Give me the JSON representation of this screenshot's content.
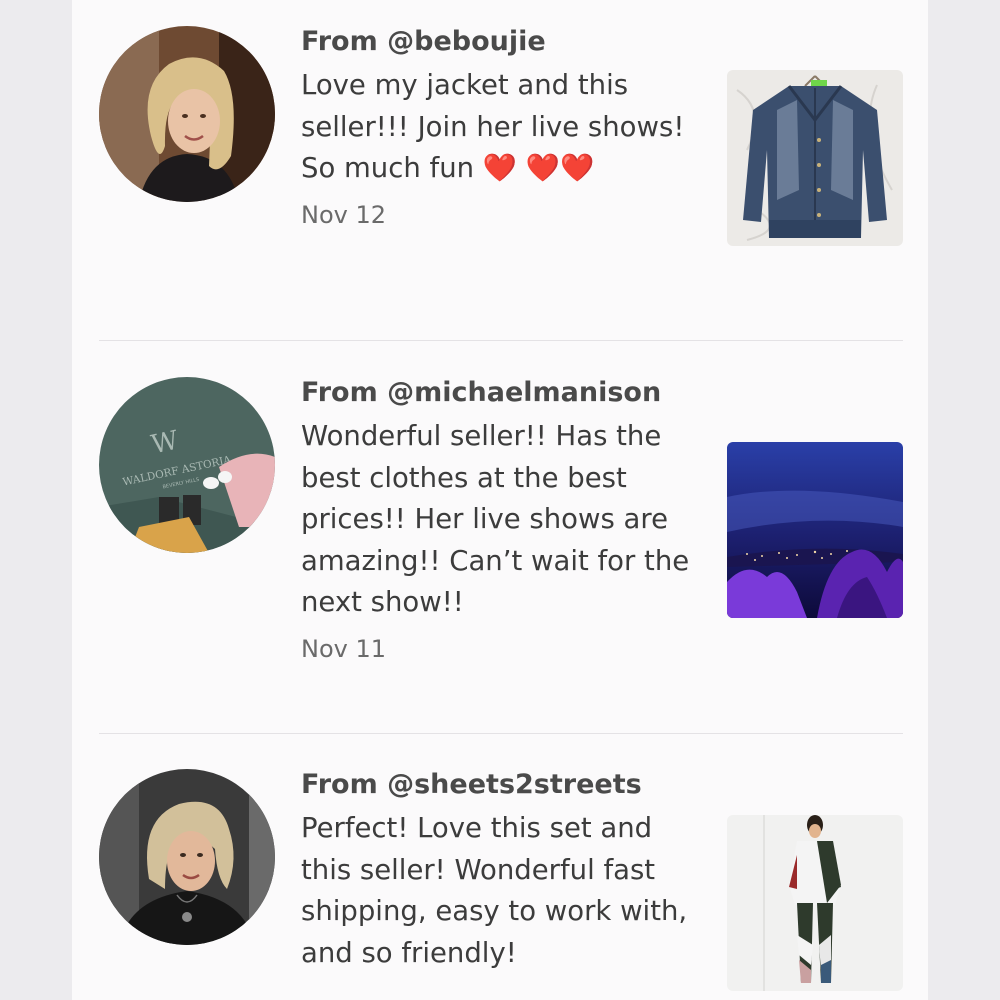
{
  "reviews": [
    {
      "from": "From @beboujie",
      "text": "Love my jacket and this seller!!! Join her live shows! So much fun ❤️ ❤️❤️",
      "date": "Nov 12"
    },
    {
      "from": "From @michaelmanison",
      "text": "Wonderful seller!! Has the best clothes at the best prices!! Her live shows are amazing!! Can’t wait for the next show!!",
      "date": "Nov 11"
    },
    {
      "from": "From @sheets2streets",
      "text": "Perfect! Love this set and this seller! Wonderful fast shipping, easy to work with, and so friendly!",
      "date": ""
    }
  ],
  "avatar_logo_text": {
    "brand": "WALDORF ASTORIA",
    "sub": "BEVERLY HILLS"
  },
  "colors": {
    "background": "#fbfafb",
    "heart": "#e0171e",
    "username": "#4a4a4a",
    "body_text": "#3c3c3c",
    "date": "#6a6a6a"
  }
}
